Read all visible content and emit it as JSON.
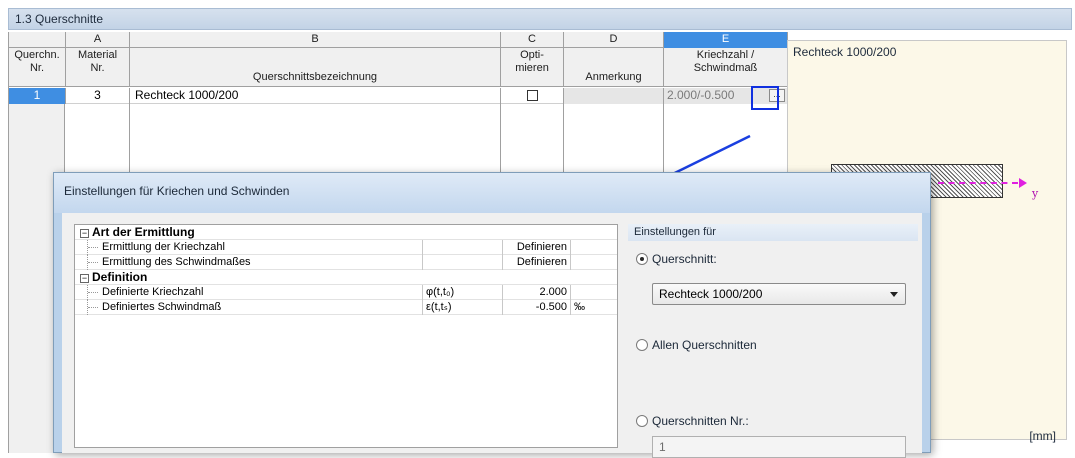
{
  "window": {
    "title": "1.3 Querschnitte"
  },
  "grid": {
    "columns": [
      "A",
      "B",
      "C",
      "D",
      "E"
    ],
    "headers": {
      "nr": [
        "Querchn.",
        "Nr."
      ],
      "material": [
        "Material",
        "Nr."
      ],
      "bezeichnung": "Querschnittsbezeichnung",
      "optimieren": [
        "Opti-",
        "mieren"
      ],
      "anmerkung": "Anmerkung",
      "kriechzahl": [
        "Kriechzahl /",
        "Schwindmaß"
      ]
    },
    "rows": [
      {
        "nr": "1",
        "material": "3",
        "bezeichnung": "Rechteck 1000/200",
        "optimieren": false,
        "anmerkung": "",
        "kriechzahl": "2.000/-0.500",
        "button": "..."
      }
    ]
  },
  "preview": {
    "title": "Rechteck 1000/200",
    "axis": "y",
    "unit": "[mm]"
  },
  "dialog": {
    "title": "Einstellungen für Kriechen und Schwinden",
    "tree": [
      {
        "label": "Art der Ermittlung",
        "group": true
      },
      {
        "label": "Ermittlung der Kriechzahl",
        "symbol": "",
        "value": "Definieren",
        "unit": ""
      },
      {
        "label": "Ermittlung des Schwindmaßes",
        "symbol": "",
        "value": "Definieren",
        "unit": ""
      },
      {
        "label": "Definition",
        "group": true
      },
      {
        "label": "Definierte Kriechzahl",
        "symbol": "φ(t,t₀)",
        "value": "2.000",
        "unit": ""
      },
      {
        "label": "Definiertes Schwindmaß",
        "symbol": "ε(t,tₛ)",
        "value": "-0.500",
        "unit": "‰"
      }
    ],
    "settings": {
      "header": "Einstellungen für",
      "option_querschnitt": "Querschnitt:",
      "combo_value": "Rechteck 1000/200",
      "option_all": "Allen Querschnitten",
      "option_nr": "Querschnitten Nr.:",
      "nr_value": "1",
      "selected": "querschnitt"
    }
  },
  "colors": {
    "selection": "#3f8ee2",
    "highlight": "#1030e0",
    "axis": "#e020e0"
  }
}
